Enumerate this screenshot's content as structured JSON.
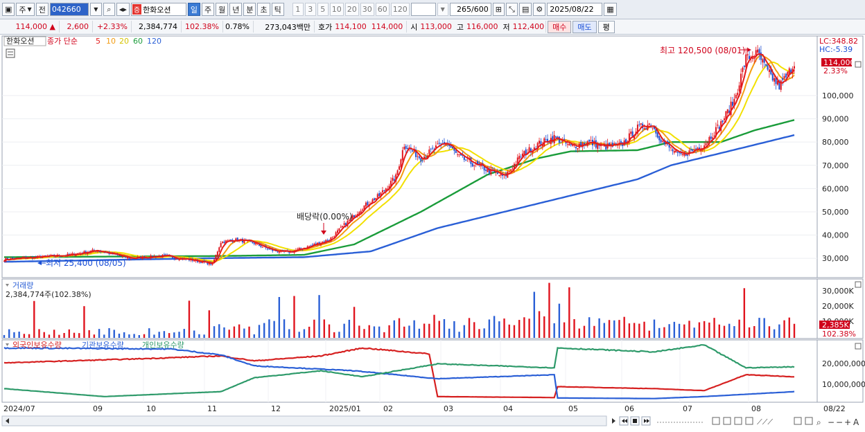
{
  "toolbar": {
    "period_select": "주",
    "prev_label": "전",
    "code_value": "042660",
    "stock_badge": "증",
    "stock_name": "한화오션",
    "period_tabs": [
      "일",
      "주",
      "월",
      "년",
      "분",
      "초",
      "틱"
    ],
    "interval_tabs": [
      "1",
      "3",
      "5",
      "10",
      "20",
      "30",
      "60",
      "120"
    ],
    "count_value": "265",
    "count_total": "/600",
    "date_value": "2025/08/22"
  },
  "quote": {
    "price": "114,000",
    "change_arrow": "▲",
    "change": "2,600",
    "change_pct": "+2.33%",
    "volume": "2,384,774",
    "volume_ratio": "102.38%",
    "turnover": "0.78%",
    "amount": "273,043백만",
    "ask_label": "호가",
    "ask1": "114,100",
    "ask2": "114,000",
    "open_label": "시",
    "open": "113,000",
    "high_label": "고",
    "high": "116,000",
    "low_label": "저",
    "low": "112,400",
    "buy_label": "매수",
    "sell_label": "매도",
    "eval_label": "평"
  },
  "price_panel": {
    "stock_label": "한화오션",
    "legend_prefix": "종가 단순",
    "legend_periods": [
      "5",
      "10",
      "20",
      "60",
      "120"
    ],
    "legend_colors": [
      "#e31a1c",
      "#f39c12",
      "#e6d300",
      "#1a9c3a",
      "#2a5fd6"
    ],
    "lc_label": "LC:348.82",
    "hc_label": "HC:-5.39",
    "last_price_label": "114,000",
    "last_pct_label": "2.33%",
    "high_annotation": "최고 120,500 (08/01)",
    "low_annotation": "최저 25,400 (08/05)",
    "dividend_annotation": "배당락(0.00%)"
  },
  "volume_panel": {
    "title": "거래량",
    "value_label": "2,384,774주(102.38%)",
    "axis_labels": [
      "30,000K",
      "20,000K",
      "10,000K"
    ],
    "last_label": "2,385K",
    "last_pct": "102.38%"
  },
  "holding_panel": {
    "legend": [
      "외국인보유수량",
      "기관보유수량",
      "개인보유수량"
    ],
    "legend_colors": [
      "#d62020",
      "#2a5fd6",
      "#2e9a6a"
    ],
    "axis_labels": [
      "20,000,000",
      "10,000,000"
    ]
  },
  "x_axis": {
    "labels": [
      "2024/07",
      "09",
      "10",
      "11",
      "12",
      "2025/01",
      "02",
      "03",
      "04",
      "05",
      "06",
      "07",
      "08"
    ],
    "end_label": "08/22"
  },
  "chart_data": {
    "type": "candlestick",
    "title": "한화오션 일봉",
    "x_range": [
      "2024/07",
      "2025/08/22"
    ],
    "y_range": [
      22000,
      125000
    ],
    "y_ticks": [
      30000,
      40000,
      50000,
      60000,
      70000,
      80000,
      90000,
      100000
    ],
    "close_path": [
      {
        "t": 0,
        "v": 29500
      },
      {
        "t": 20,
        "v": 30500
      },
      {
        "t": 40,
        "v": 31500
      },
      {
        "t": 55,
        "v": 33500
      },
      {
        "t": 75,
        "v": 30000
      },
      {
        "t": 95,
        "v": 31000
      },
      {
        "t": 115,
        "v": 29000
      },
      {
        "t": 125,
        "v": 27500
      },
      {
        "t": 130,
        "v": 37000
      },
      {
        "t": 140,
        "v": 38000
      },
      {
        "t": 150,
        "v": 36500
      },
      {
        "t": 160,
        "v": 33500
      },
      {
        "t": 170,
        "v": 32500
      },
      {
        "t": 180,
        "v": 34500
      },
      {
        "t": 195,
        "v": 38000
      },
      {
        "t": 205,
        "v": 45000
      },
      {
        "t": 215,
        "v": 52000
      },
      {
        "t": 225,
        "v": 57000
      },
      {
        "t": 235,
        "v": 65000
      },
      {
        "t": 240,
        "v": 79000
      },
      {
        "t": 250,
        "v": 73000
      },
      {
        "t": 258,
        "v": 77000
      },
      {
        "t": 265,
        "v": 80000
      },
      {
        "t": 272,
        "v": 74000
      },
      {
        "t": 280,
        "v": 71000
      },
      {
        "t": 290,
        "v": 68000
      },
      {
        "t": 300,
        "v": 65000
      },
      {
        "t": 310,
        "v": 74000
      },
      {
        "t": 320,
        "v": 79000
      },
      {
        "t": 330,
        "v": 82000
      },
      {
        "t": 340,
        "v": 78000
      },
      {
        "t": 350,
        "v": 80000
      },
      {
        "t": 360,
        "v": 78000
      },
      {
        "t": 370,
        "v": 78500
      },
      {
        "t": 380,
        "v": 86000
      },
      {
        "t": 388,
        "v": 88000
      },
      {
        "t": 395,
        "v": 80000
      },
      {
        "t": 405,
        "v": 74000
      },
      {
        "t": 412,
        "v": 76000
      },
      {
        "t": 420,
        "v": 79000
      },
      {
        "t": 430,
        "v": 88000
      },
      {
        "t": 438,
        "v": 98000
      },
      {
        "t": 445,
        "v": 116000
      },
      {
        "t": 452,
        "v": 118000
      },
      {
        "t": 458,
        "v": 110000
      },
      {
        "t": 465,
        "v": 104000
      },
      {
        "t": 470,
        "v": 109000
      },
      {
        "t": 474,
        "v": 114000
      }
    ],
    "ma60_path": [
      {
        "t": 0,
        "v": 30500
      },
      {
        "t": 130,
        "v": 31000
      },
      {
        "t": 180,
        "v": 31500
      },
      {
        "t": 210,
        "v": 36000
      },
      {
        "t": 250,
        "v": 50000
      },
      {
        "t": 290,
        "v": 66000
      },
      {
        "t": 320,
        "v": 73000
      },
      {
        "t": 340,
        "v": 76000
      },
      {
        "t": 380,
        "v": 76500
      },
      {
        "t": 400,
        "v": 80000
      },
      {
        "t": 430,
        "v": 80000
      },
      {
        "t": 450,
        "v": 85000
      },
      {
        "t": 474,
        "v": 89500
      }
    ],
    "ma120_path": [
      {
        "t": 0,
        "v": 28500
      },
      {
        "t": 120,
        "v": 30000
      },
      {
        "t": 180,
        "v": 30500
      },
      {
        "t": 220,
        "v": 33000
      },
      {
        "t": 260,
        "v": 43000
      },
      {
        "t": 300,
        "v": 50000
      },
      {
        "t": 340,
        "v": 57000
      },
      {
        "t": 380,
        "v": 64000
      },
      {
        "t": 400,
        "v": 70000
      },
      {
        "t": 440,
        "v": 77000
      },
      {
        "t": 474,
        "v": 83000
      }
    ],
    "holding_series": [
      {
        "name": "외국인보유수량",
        "color": "#d62020",
        "path": [
          {
            "t": 0,
            "v": 19500000
          },
          {
            "t": 80,
            "v": 21500000
          },
          {
            "t": 130,
            "v": 23000000
          },
          {
            "t": 150,
            "v": 20500000
          },
          {
            "t": 190,
            "v": 23000000
          },
          {
            "t": 215,
            "v": 27000000
          },
          {
            "t": 255,
            "v": 24000000
          },
          {
            "t": 260,
            "v": 2500000
          },
          {
            "t": 330,
            "v": 2000000
          },
          {
            "t": 332,
            "v": 7500000
          },
          {
            "t": 390,
            "v": 6500000
          },
          {
            "t": 420,
            "v": 5500000
          },
          {
            "t": 445,
            "v": 13500000
          },
          {
            "t": 474,
            "v": 12500000
          }
        ]
      },
      {
        "name": "기관보유수량",
        "color": "#2a5fd6",
        "path": [
          {
            "t": 0,
            "v": 27000000
          },
          {
            "t": 100,
            "v": 26500000
          },
          {
            "t": 130,
            "v": 23500000
          },
          {
            "t": 150,
            "v": 18000000
          },
          {
            "t": 210,
            "v": 15500000
          },
          {
            "t": 260,
            "v": 11500000
          },
          {
            "t": 330,
            "v": 13500000
          },
          {
            "t": 332,
            "v": 1800000
          },
          {
            "t": 390,
            "v": 1500000
          },
          {
            "t": 420,
            "v": 2500000
          },
          {
            "t": 474,
            "v": 5000000
          }
        ]
      },
      {
        "name": "개인보유수량",
        "color": "#2e9a6a",
        "path": [
          {
            "t": 0,
            "v": 6500000
          },
          {
            "t": 60,
            "v": 2500000
          },
          {
            "t": 130,
            "v": 5000000
          },
          {
            "t": 150,
            "v": 12000000
          },
          {
            "t": 190,
            "v": 15500000
          },
          {
            "t": 215,
            "v": 12500000
          },
          {
            "t": 260,
            "v": 19000000
          },
          {
            "t": 330,
            "v": 17000000
          },
          {
            "t": 332,
            "v": 27000000
          },
          {
            "t": 390,
            "v": 25000000
          },
          {
            "t": 420,
            "v": 28500000
          },
          {
            "t": 445,
            "v": 17000000
          },
          {
            "t": 474,
            "v": 17500000
          }
        ]
      }
    ]
  }
}
